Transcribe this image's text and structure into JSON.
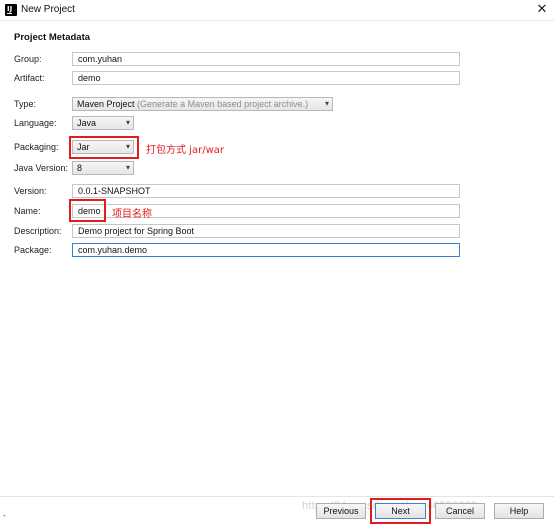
{
  "window": {
    "title": "New Project",
    "close_glyph": "✕"
  },
  "section_title": "Project Metadata",
  "form": {
    "group": {
      "label": "Group:",
      "value": "com.yuhan"
    },
    "artifact": {
      "label": "Artifact:",
      "value": "demo"
    },
    "type": {
      "label": "Type:",
      "value": "Maven Project",
      "hint": "(Generate a Maven based project archive.)"
    },
    "language": {
      "label": "Language:",
      "value": "Java"
    },
    "packaging": {
      "label": "Packaging:",
      "value": "Jar"
    },
    "java_version": {
      "label": "Java Version:",
      "value": "8"
    },
    "version": {
      "label": "Version:",
      "value": "0.0.1-SNAPSHOT"
    },
    "name": {
      "label": "Name:",
      "value": "demo"
    },
    "description": {
      "label": "Description:",
      "value": "Demo project for Spring Boot"
    },
    "package": {
      "label": "Package:",
      "value": "com.yuhan.demo"
    }
  },
  "annotations": {
    "packaging_note": "打包方式 jar/war",
    "name_note": "项目名称"
  },
  "buttons": {
    "previous": "Previous",
    "next": "Next",
    "cancel": "Cancel",
    "help": "Help"
  },
  "watermark": "https://blog.csdn.net/qq_40550832",
  "corner_text": "-",
  "colors": {
    "annotation_red": "#e21b1b",
    "focus_blue": "#3c7fd6"
  },
  "icons": {
    "app": "intellij-idea-icon",
    "dropdown": "chevron-down-icon",
    "close": "close-icon"
  }
}
